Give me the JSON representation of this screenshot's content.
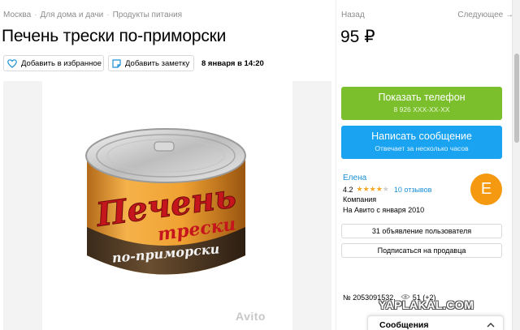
{
  "breadcrumbs": [
    "Москва",
    "Для дома и дачи",
    "Продукты питания"
  ],
  "title": "Печень трески по-приморски",
  "nav": {
    "prev": "Назад",
    "next": "Следующее →"
  },
  "price": "95 ₽",
  "actions": {
    "favorite": "Добавить в избранное",
    "note": "Добавить заметку"
  },
  "date": "8 января в 14:20",
  "product_image": {
    "line1": "Печень",
    "line2": "трески",
    "line3": "по-приморски",
    "watermark": "Avito"
  },
  "contact": {
    "phone_label": "Показать телефон",
    "phone_number": "8 926 XXX-XX-XX",
    "message_label": "Написать сообщение",
    "message_sub": "Отвечает за несколько часов"
  },
  "seller": {
    "name": "Елена",
    "rating": "4.2",
    "stars_filled": 4,
    "stars_total": 5,
    "reviews": "10 отзывов",
    "type": "Компания",
    "since": "На Авито с января 2010",
    "avatar_letter": "E"
  },
  "seller_actions": {
    "ads_count": "31 объявление пользователя",
    "subscribe": "Подписаться на продавца"
  },
  "listing": {
    "number": "№ 2053091532,",
    "views": "51 (+2)"
  },
  "overlay_watermark": "YAPLAKAL.COM",
  "messages_bar": {
    "label": "Сообщения"
  },
  "colors": {
    "green": "#7bbf2c",
    "blue": "#1aa3f0",
    "avatar": "#f59a10",
    "link": "#1a8fd6"
  }
}
